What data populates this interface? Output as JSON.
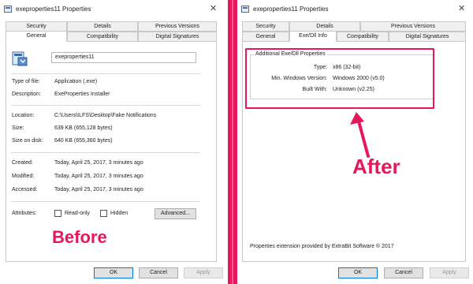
{
  "colors": {
    "annotation": "#e8175d",
    "accent": "#0078d7"
  },
  "icons": {
    "title": "program-window-icon",
    "file": "installer-file-icon",
    "close": "close-icon"
  },
  "left_window": {
    "title": "exeproperties11 Properties",
    "close_glyph": "✕",
    "tabs_row1": [
      "Security",
      "Details",
      "Previous Versions"
    ],
    "tabs_row2": [
      "General",
      "Compatibility",
      "Digital Signatures"
    ],
    "active_tab": "General",
    "file_name": "exeproperties11",
    "fields": [
      {
        "label": "Type of file:",
        "value": "Application (.exe)"
      },
      {
        "label": "Description:",
        "value": "ExeProperties Installer"
      },
      {
        "label": "Location:",
        "value": "C:\\Users\\ILFS\\Desktop\\Fake Notifications"
      },
      {
        "label": "Size:",
        "value": "639 KB (655,128 bytes)"
      },
      {
        "label": "Size on disk:",
        "value": "640 KB (655,360 bytes)"
      },
      {
        "label": "Created:",
        "value": "Today, April 25, 2017, 3 minutes ago"
      },
      {
        "label": "Modified:",
        "value": "Today, April 25, 2017, 3 minutes ago"
      },
      {
        "label": "Accessed:",
        "value": "Today, April 25, 2017, 3 minutes ago"
      }
    ],
    "attributes_label": "Attributes:",
    "read_only_label": "Read-only",
    "hidden_label": "Hidden",
    "advanced_label": "Advanced...",
    "buttons": {
      "ok": "OK",
      "cancel": "Cancel",
      "apply": "Apply"
    }
  },
  "right_window": {
    "title": "exeproperties11 Properties",
    "close_glyph": "✕",
    "tabs_row1": [
      "Security",
      "Details",
      "Previous Versions"
    ],
    "tabs_row2": [
      "General",
      "Exe/Dll Info",
      "Compatibility",
      "Digital Signatures"
    ],
    "active_tab": "Exe/Dll Info",
    "group_title": "Additional Exe/Dll Properties",
    "fields": [
      {
        "label": "Type:",
        "value": "x86 (32-bit)"
      },
      {
        "label": "Min. Windows Version:",
        "value": "Windows 2000 (v5.0)"
      },
      {
        "label": "Built With:",
        "value": "Unknown (v2.25)"
      }
    ],
    "footer_note": "Properties extension provided by ExtraBit Software ® 2017",
    "buttons": {
      "ok": "OK",
      "cancel": "Cancel",
      "apply": "Apply"
    }
  },
  "annotations": {
    "before": "Before",
    "after": "After"
  }
}
